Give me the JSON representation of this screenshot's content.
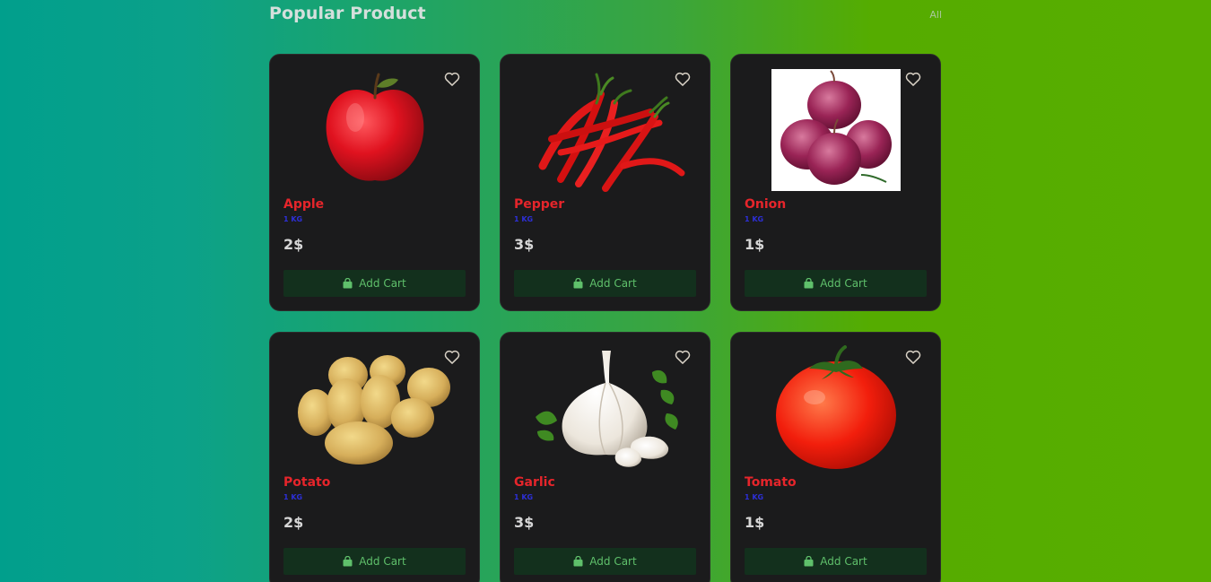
{
  "header": {
    "title": "Popular Product",
    "all_label": "All"
  },
  "colors": {
    "product_name": "#e6252b",
    "weight": "#2d2fd8",
    "price": "#d7d7d7",
    "card_bg": "#1b1b1c",
    "button_bg": "#13301d",
    "button_text": "#5fc06b"
  },
  "products": [
    {
      "name": "Apple",
      "weight": "1 KG",
      "price": "2$",
      "button": "Add Cart",
      "icon": "apple-image"
    },
    {
      "name": "Pepper",
      "weight": "1 KG",
      "price": "3$",
      "button": "Add Cart",
      "icon": "pepper-image"
    },
    {
      "name": "Onion",
      "weight": "1 KG",
      "price": "1$",
      "button": "Add Cart",
      "icon": "onion-image"
    },
    {
      "name": "Potato",
      "weight": "1 KG",
      "price": "2$",
      "button": "Add Cart",
      "icon": "potato-image"
    },
    {
      "name": "Garlic",
      "weight": "1 KG",
      "price": "3$",
      "button": "Add Cart",
      "icon": "garlic-image"
    },
    {
      "name": "Tomato",
      "weight": "1 KG",
      "price": "1$",
      "button": "Add Cart",
      "icon": "tomato-image"
    }
  ]
}
